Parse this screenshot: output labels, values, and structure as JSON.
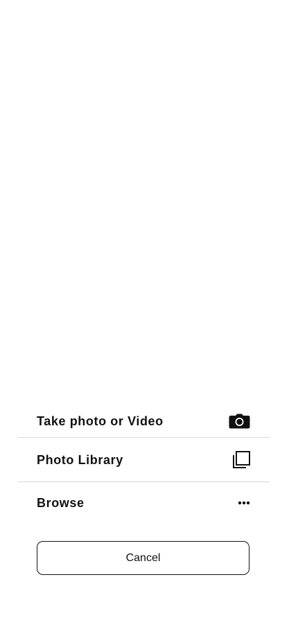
{
  "action_sheet": {
    "options": [
      {
        "label": "Take photo or Video",
        "icon": "camera-icon"
      },
      {
        "label": "Photo Library",
        "icon": "photo-library-icon"
      },
      {
        "label": "Browse",
        "icon": "more-horizontal-icon"
      }
    ],
    "cancel_label": "Cancel"
  },
  "colors": {
    "background": "#ffffff",
    "text": "#111111",
    "divider": "#d9d9d9"
  }
}
